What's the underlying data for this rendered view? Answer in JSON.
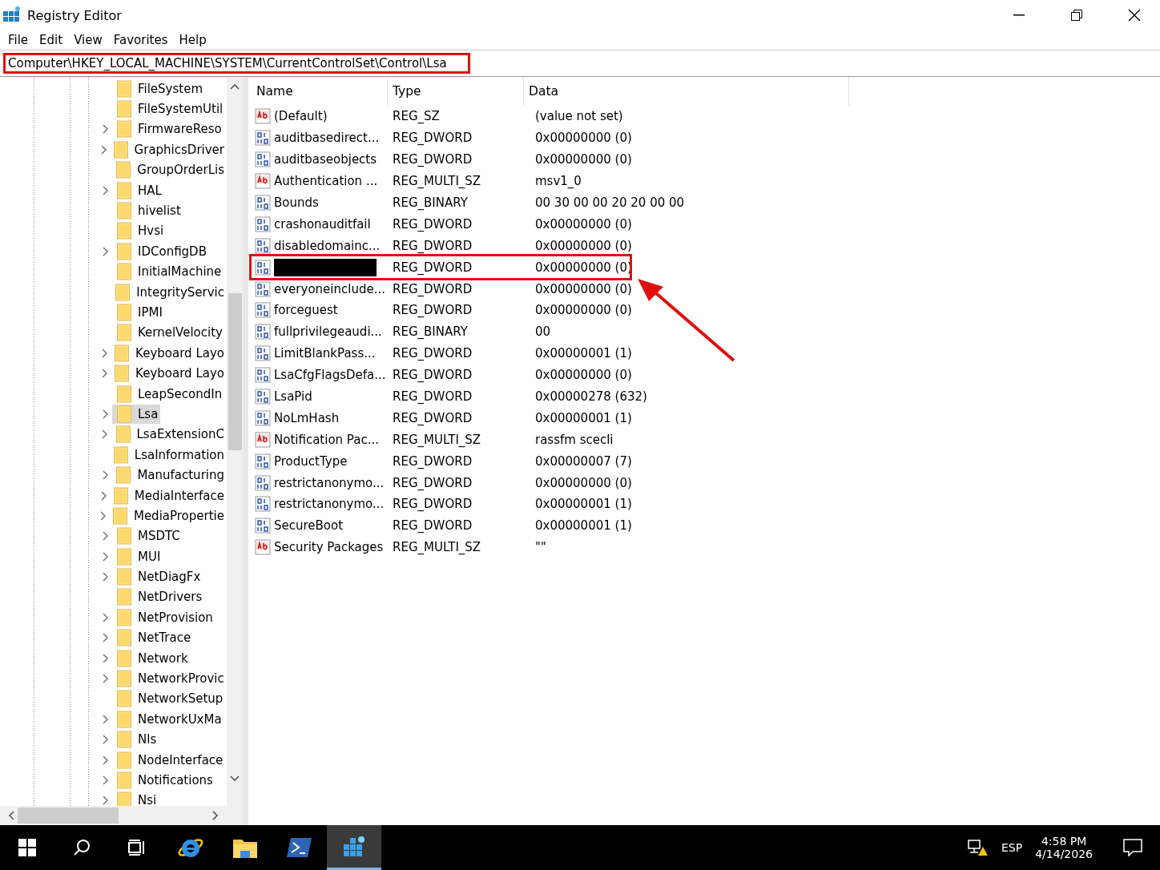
{
  "window": {
    "title": "Registry Editor"
  },
  "menu": [
    "File",
    "Edit",
    "View",
    "Favorites",
    "Help"
  ],
  "address": {
    "value": "Computer\\HKEY_LOCAL_MACHINE\\SYSTEM\\CurrentControlSet\\Control\\Lsa",
    "highlighted": true
  },
  "tree": [
    {
      "label": "FileSystem",
      "expandable": false,
      "selected": false
    },
    {
      "label": "FileSystemUtil",
      "expandable": false,
      "selected": false
    },
    {
      "label": "FirmwareReso",
      "expandable": true,
      "selected": false
    },
    {
      "label": "GraphicsDriver",
      "expandable": true,
      "selected": false
    },
    {
      "label": "GroupOrderLis",
      "expandable": false,
      "selected": false
    },
    {
      "label": "HAL",
      "expandable": true,
      "selected": false
    },
    {
      "label": "hivelist",
      "expandable": false,
      "selected": false
    },
    {
      "label": "Hvsi",
      "expandable": false,
      "selected": false
    },
    {
      "label": "IDConfigDB",
      "expandable": true,
      "selected": false
    },
    {
      "label": "InitialMachine",
      "expandable": false,
      "selected": false
    },
    {
      "label": "IntegrityServic",
      "expandable": false,
      "selected": false
    },
    {
      "label": "IPMI",
      "expandable": false,
      "selected": false
    },
    {
      "label": "KernelVelocity",
      "expandable": false,
      "selected": false
    },
    {
      "label": "Keyboard Layo",
      "expandable": true,
      "selected": false
    },
    {
      "label": "Keyboard Layo",
      "expandable": true,
      "selected": false
    },
    {
      "label": "LeapSecondIn",
      "expandable": false,
      "selected": false
    },
    {
      "label": "Lsa",
      "expandable": true,
      "selected": true
    },
    {
      "label": "LsaExtensionC",
      "expandable": true,
      "selected": false
    },
    {
      "label": "LsaInformation",
      "expandable": false,
      "selected": false
    },
    {
      "label": "Manufacturing",
      "expandable": true,
      "selected": false
    },
    {
      "label": "MediaInterface",
      "expandable": true,
      "selected": false
    },
    {
      "label": "MediaPropertie",
      "expandable": true,
      "selected": false
    },
    {
      "label": "MSDTC",
      "expandable": true,
      "selected": false
    },
    {
      "label": "MUI",
      "expandable": true,
      "selected": false
    },
    {
      "label": "NetDiagFx",
      "expandable": true,
      "selected": false
    },
    {
      "label": "NetDrivers",
      "expandable": false,
      "selected": false
    },
    {
      "label": "NetProvision",
      "expandable": true,
      "selected": false
    },
    {
      "label": "NetTrace",
      "expandable": true,
      "selected": false
    },
    {
      "label": "Network",
      "expandable": true,
      "selected": false
    },
    {
      "label": "NetworkProvic",
      "expandable": true,
      "selected": false
    },
    {
      "label": "NetworkSetup",
      "expandable": false,
      "selected": false
    },
    {
      "label": "NetworkUxMa",
      "expandable": true,
      "selected": false
    },
    {
      "label": "Nls",
      "expandable": true,
      "selected": false
    },
    {
      "label": "NodeInterface",
      "expandable": true,
      "selected": false
    },
    {
      "label": "Notifications",
      "expandable": true,
      "selected": false
    },
    {
      "label": "Nsi",
      "expandable": true,
      "selected": false
    }
  ],
  "table": {
    "columns": [
      "Name",
      "Type",
      "Data"
    ],
    "rows": [
      {
        "kind": "string",
        "name": "(Default)",
        "type": "REG_SZ",
        "data": "(value not set)"
      },
      {
        "kind": "binary",
        "name": "auditbasedirect...",
        "type": "REG_DWORD",
        "data": "0x00000000 (0)"
      },
      {
        "kind": "binary",
        "name": "auditbaseobjects",
        "type": "REG_DWORD",
        "data": "0x00000000 (0)"
      },
      {
        "kind": "string",
        "name": "Authentication ...",
        "type": "REG_MULTI_SZ",
        "data": "msv1_0"
      },
      {
        "kind": "binary",
        "name": "Bounds",
        "type": "REG_BINARY",
        "data": "00 30 00 00 20 20 00 00"
      },
      {
        "kind": "binary",
        "name": "crashonauditfail",
        "type": "REG_DWORD",
        "data": "0x00000000 (0)"
      },
      {
        "kind": "binary",
        "name": "disabledomainc...",
        "type": "REG_DWORD",
        "data": "0x00000000 (0)"
      },
      {
        "kind": "binary",
        "redacted": true,
        "highlighted": true,
        "type": "REG_DWORD",
        "data": "0x00000000 (0)"
      },
      {
        "kind": "binary",
        "name": "everyoneinclude...",
        "type": "REG_DWORD",
        "data": "0x00000000 (0)"
      },
      {
        "kind": "binary",
        "name": "forceguest",
        "type": "REG_DWORD",
        "data": "0x00000000 (0)"
      },
      {
        "kind": "binary",
        "name": "fullprivilegeaudi...",
        "type": "REG_BINARY",
        "data": "00"
      },
      {
        "kind": "binary",
        "name": "LimitBlankPass...",
        "type": "REG_DWORD",
        "data": "0x00000001 (1)"
      },
      {
        "kind": "binary",
        "name": "LsaCfgFlagsDefa...",
        "type": "REG_DWORD",
        "data": "0x00000000 (0)"
      },
      {
        "kind": "binary",
        "name": "LsaPid",
        "type": "REG_DWORD",
        "data": "0x00000278 (632)"
      },
      {
        "kind": "binary",
        "name": "NoLmHash",
        "type": "REG_DWORD",
        "data": "0x00000001 (1)"
      },
      {
        "kind": "string",
        "name": "Notification Pac...",
        "type": "REG_MULTI_SZ",
        "data": "rassfm scecli"
      },
      {
        "kind": "binary",
        "name": "ProductType",
        "type": "REG_DWORD",
        "data": "0x00000007 (7)"
      },
      {
        "kind": "binary",
        "name": "restrictanonymo...",
        "type": "REG_DWORD",
        "data": "0x00000000 (0)"
      },
      {
        "kind": "binary",
        "name": "restrictanonymo...",
        "type": "REG_DWORD",
        "data": "0x00000001 (1)"
      },
      {
        "kind": "binary",
        "name": "SecureBoot",
        "type": "REG_DWORD",
        "data": "0x00000001 (1)"
      },
      {
        "kind": "string",
        "name": "Security Packages",
        "type": "REG_MULTI_SZ",
        "data": "\"\""
      }
    ]
  },
  "taskbar": {
    "apps": [
      {
        "kind": "search"
      },
      {
        "kind": "taskview"
      },
      {
        "kind": "browser",
        "active": false
      },
      {
        "kind": "folder",
        "active": false
      },
      {
        "kind": "shell",
        "active": false
      },
      {
        "kind": "registry",
        "active": true
      }
    ],
    "language": "ESP",
    "time": "4:58 PM",
    "date": "4/14/2026"
  }
}
